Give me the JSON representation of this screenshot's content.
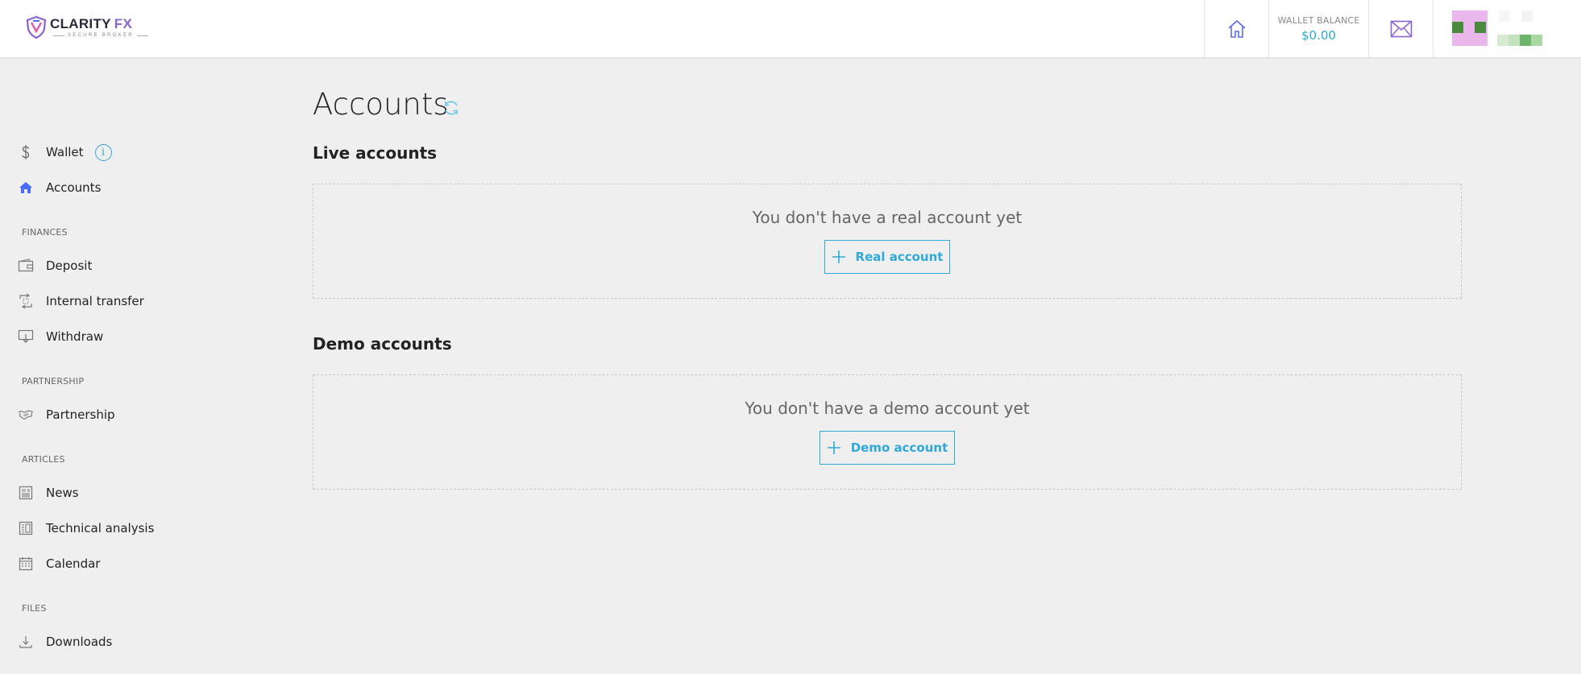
{
  "brand": {
    "name": "CLARITY",
    "accent": "FX",
    "tagline": "SECURE BROKER"
  },
  "header": {
    "wallet_balance_label": "WALLET BALANCE",
    "wallet_balance_value": "$0.00"
  },
  "sidebar": {
    "items_top": [
      {
        "label": "Wallet",
        "icon": "dollar-icon",
        "info_glyph": "i"
      },
      {
        "label": "Accounts",
        "icon": "home-icon",
        "active": true
      }
    ],
    "sections": [
      {
        "title": "FINANCES",
        "items": [
          {
            "label": "Deposit",
            "icon": "wallet-icon"
          },
          {
            "label": "Internal transfer",
            "icon": "transfer-icon"
          },
          {
            "label": "Withdraw",
            "icon": "withdraw-icon"
          }
        ]
      },
      {
        "title": "PARTNERSHIP",
        "items": [
          {
            "label": "Partnership",
            "icon": "handshake-icon"
          }
        ]
      },
      {
        "title": "ARTICLES",
        "items": [
          {
            "label": "News",
            "icon": "newspaper-icon"
          },
          {
            "label": "Technical analysis",
            "icon": "analysis-icon"
          },
          {
            "label": "Calendar",
            "icon": "calendar-icon"
          }
        ]
      },
      {
        "title": "FILES",
        "items": [
          {
            "label": "Downloads",
            "icon": "download-icon"
          }
        ]
      }
    ]
  },
  "main": {
    "title": "Accounts",
    "live": {
      "heading": "Live accounts",
      "empty_text": "You don't have a real account yet",
      "button_label": "Real account"
    },
    "demo": {
      "heading": "Demo accounts",
      "empty_text": "You don't have a demo account yet",
      "button_label": "Demo account"
    }
  },
  "colors": {
    "accent": "#2fa9d9",
    "nav_active_icon": "#4b6bff",
    "brand_purple": "#8a63d2"
  }
}
